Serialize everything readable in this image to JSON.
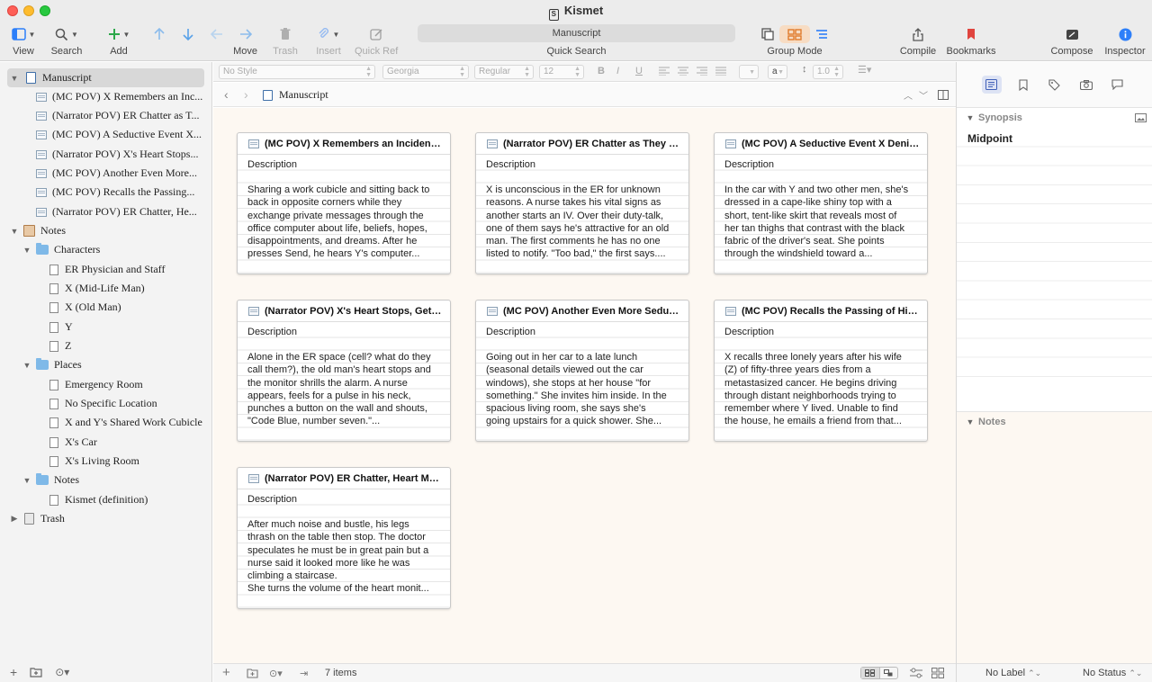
{
  "window": {
    "title": "Kismet"
  },
  "toolbar": {
    "view": "View",
    "search": "Search",
    "add": "Add",
    "move": "Move",
    "trash": "Trash",
    "insert": "Insert",
    "quick_ref": "Quick Ref",
    "quick_search_value": "Manuscript",
    "quick_search": "Quick Search",
    "group_mode": "Group Mode",
    "compile": "Compile",
    "bookmarks": "Bookmarks",
    "compose": "Compose",
    "inspector": "Inspector"
  },
  "format_bar": {
    "style": "No Style",
    "font": "Georgia",
    "weight": "Regular",
    "size": "12",
    "bold": "B",
    "italic": "I",
    "underline": "U",
    "highlight": "a",
    "line_spacing": "1.0"
  },
  "binder": {
    "manuscript": {
      "label": "Manuscript",
      "items": [
        "(MC POV) X Remembers an Inc...",
        "(Narrator POV) ER Chatter as T...",
        "(MC POV) A Seductive Event X...",
        "(Narrator POV) X's Heart Stops...",
        "(MC POV) Another Even More...",
        "(MC POV) Recalls the Passing...",
        "(Narrator POV) ER Chatter, He..."
      ]
    },
    "notes": {
      "label": "Notes",
      "characters": {
        "label": "Characters",
        "items": [
          "ER Physician and Staff",
          "X (Mid-Life Man)",
          "X (Old Man)",
          "Y",
          "Z"
        ]
      },
      "places": {
        "label": "Places",
        "items": [
          "Emergency Room",
          "No Specific Location",
          "X and Y's Shared Work Cubicle",
          "X's Car",
          "X's Living Room"
        ]
      },
      "notes_folder": {
        "label": "Notes",
        "items": [
          "Kismet (definition)"
        ]
      }
    },
    "trash": {
      "label": "Trash"
    }
  },
  "editor": {
    "header_title": "Manuscript",
    "item_count": "7 items"
  },
  "cards": [
    {
      "title": "(MC POV) X Remembers an Incident I...",
      "desc": "Description",
      "text": "Sharing a work cubicle and sitting back to\nback in opposite corners while they\nexchange private messages through the\noffice computer about life, beliefs, hopes,\ndisappointments, and dreams. After he\npresses Send, he hears Y's computer..."
    },
    {
      "title": "(Narrator POV) ER Chatter as They Tr...",
      "desc": "Description",
      "text": "X is unconscious in the ER for unknown\nreasons. A nurse takes his vital signs as\nanother starts an IV. Over their duty-talk,\none of them says he's attractive for an old\nman. The first comments he has no one\nlisted to notify. \"Too bad,\" the first says...."
    },
    {
      "title": "(MC POV) A Seductive Event X Denie...",
      "desc": "Description",
      "text": "In the car with Y and two other men, she's\ndressed in a cape-like shiny top with a\nshort, tent-like skirt that reveals most of\nher tan thighs that contrast with the black\nfabric of the driver's seat. She points\nthrough the windshield toward a..."
    },
    {
      "title": "(Narrator POV) X's Heart Stops, Gets...",
      "desc": "Description",
      "text": "Alone in the ER space (cell? what do they\ncall them?), the old man's heart stops and\nthe monitor shrills the alarm. A nurse\nappears, feels for a pulse in his neck,\npunches a button on the wall and shouts,\n\"Code Blue, number seven.\"..."
    },
    {
      "title": "(MC POV) Another Even More Seducti...",
      "desc": "Description",
      "text": "Going out in her car to a late lunch\n(seasonal details viewed out the car\nwindows), she stops at her house \"for\nsomething.\" She invites him inside. In the\nspacious living room, she says she's\ngoing upstairs for a quick shower. She..."
    },
    {
      "title": "(MC POV) Recalls the Passing of His...",
      "desc": "Description",
      "text": "X recalls three lonely years after his wife\n(Z) of fifty-three years dies from a\nmetastasized cancer. He begins driving\nthrough distant neighborhoods trying to\nremember where Y lived. Unable to find\nthe house, he emails a friend from that..."
    },
    {
      "title": "(Narrator POV) ER Chatter, Heart Mon...",
      "desc": "Description",
      "text": "After much noise and bustle, his legs\nthrash on the table then stop. The doctor\nspeculates he must be in great pain but a\nnurse said it looked more like he was\nclimbing a staircase.\nShe turns the volume of the heart monit..."
    }
  ],
  "inspector": {
    "synopsis_label": "Synopsis",
    "synopsis_text": "Midpoint",
    "notes_label": "Notes",
    "label_value": "No Label",
    "status_value": "No Status"
  },
  "colors": {
    "accent": "#2d7ff9",
    "add_green": "#2ca84a",
    "move_blue": "#5aa2e8",
    "bookmark_red": "#e0443e",
    "group_mode_active": "#f7dcc3",
    "corkboard_bg": "#fdf8f2"
  }
}
